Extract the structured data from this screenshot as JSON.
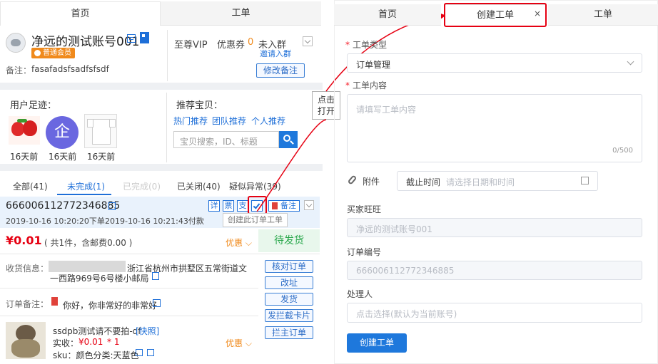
{
  "left": {
    "tabs": [
      "首页",
      "工单"
    ],
    "account": {
      "name": "净远的测试账号001",
      "badge": "普通会员",
      "note_label": "备注：",
      "note_value": "fasafadsfsadfsfsdf",
      "vip": "至尊VIP",
      "coupon_label": "优惠券",
      "coupon_count": "0",
      "group_status": "未入群",
      "invite_link": "邀请入群",
      "edit_note_button": "修改备注"
    },
    "footprint": {
      "title": "用户足迹：",
      "items": [
        "16天前",
        "16天前",
        "16天前"
      ],
      "logo_char": "企"
    },
    "recommend": {
      "title": "推荐宝贝：",
      "links": [
        "热门推荐",
        "团队推荐",
        "个人推荐"
      ],
      "search_placeholder": "宝贝搜索，ID、标题"
    },
    "order_tabs": [
      "全部(41)",
      "未完成(1)",
      "已完成(0)",
      "已关闭(40)",
      "疑似异常(39)"
    ],
    "order": {
      "id": "666006112772346885",
      "created": "2019-10-16 10:20:20下单",
      "paid": "2019-10-16 10:21:43付款",
      "icon_labels": [
        "详",
        "票",
        "支"
      ],
      "remark_button": "备注",
      "tooltip": "创建此订单工单",
      "price": "¥0.01",
      "price_detail": "( 共1件，含邮费0.00 )",
      "discount": "优惠",
      "status": "待发货",
      "address_label": "收货信息：",
      "address_line1": "浙江省杭州市拱墅区五常街道文",
      "address_line2": "一西路969号6号楼小邮局",
      "remark_label": "订单备注：",
      "remark_text": "你好，你非常好的非常好",
      "action_buttons": [
        "核对订单",
        "改址",
        "发货",
        "发拦截卡片",
        "拦主订单"
      ],
      "product_title": "ssdpb测试请不要拍-df",
      "product_quick": "[快照]",
      "paid_label": "实收：",
      "paid_value": "¥0.01",
      "qty": "* 1",
      "sku": "sku：颜色分类:天蓝色",
      "discount2": "优惠"
    }
  },
  "callout": {
    "line1": "点击",
    "line2": "打开"
  },
  "right": {
    "tabs": [
      "首页",
      "创建工单",
      "工单"
    ],
    "close_char": "×",
    "type_label": "工单类型",
    "type_value": "订单管理",
    "content_label": "工单内容",
    "content_placeholder": "请填写工单内容",
    "content_counter": "0/500",
    "attach_label": "附件",
    "deadline_label": "截止时间",
    "deadline_placeholder": "请选择日期和时间",
    "buyer_label": "买家旺旺",
    "buyer_value": "净远的测试账号001",
    "order_label": "订单编号",
    "order_value": "666006112772346885",
    "handler_label": "处理人",
    "handler_placeholder": "点击选择(默认为当前账号)",
    "submit_button": "创建工单"
  },
  "colors": {
    "accent": "#1e6fd8",
    "price_red": "#e60012",
    "status_green": "#27a74a",
    "annotation_red": "#e60012"
  }
}
